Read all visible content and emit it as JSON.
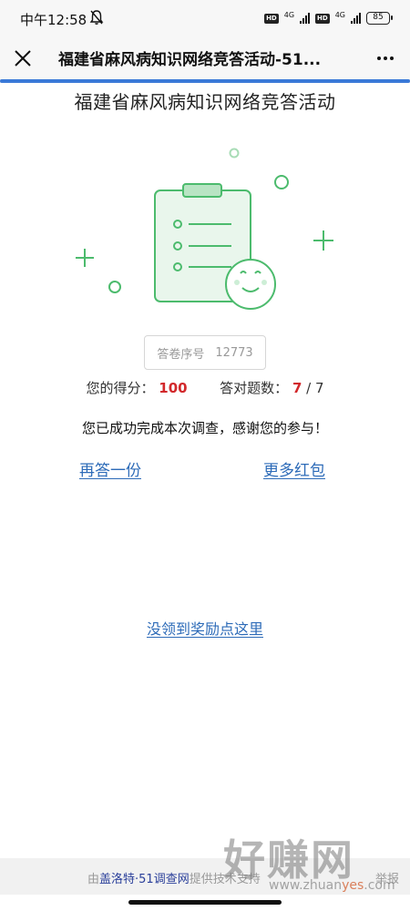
{
  "status_bar": {
    "time": "中午12:58",
    "network1": "4G",
    "network2": "4G",
    "hd": "HD",
    "battery": "85"
  },
  "title_bar": {
    "title": "福建省麻风病知识网络竞答活动-51...",
    "progress": 1.0,
    "accent": "#3a79d8"
  },
  "survey": {
    "title": "福建省麻风病知识网络竞答活动",
    "answer_no_label": "答卷序号",
    "answer_no_value": "12773",
    "score_label": "您的得分：",
    "score_value": "100",
    "correct_label": "答对题数：",
    "correct_value": "7",
    "correct_sep": " / ",
    "total_value": "7",
    "thanks": "您已成功完成本次调查，感谢您的参与！",
    "retry_link": "再答一份",
    "more_link": "更多红包",
    "reward_link": "没领到奖励点这里",
    "score_color": "#d2282b",
    "link_color": "#2d6bb8"
  },
  "footer": {
    "prefix": "由",
    "brand": "盖洛特·51调查网",
    "suffix": "提供技术支持",
    "report": "举报"
  },
  "watermark": {
    "main": "好赚网",
    "url_prefix": "www.zhuan",
    "url_highlight": "yes",
    "url_suffix": ".com"
  },
  "icons": {
    "close": "close-icon",
    "more": "more-dots-icon",
    "bell": "bell-muted-icon",
    "illustration": "clipboard-smiley-illustration"
  }
}
